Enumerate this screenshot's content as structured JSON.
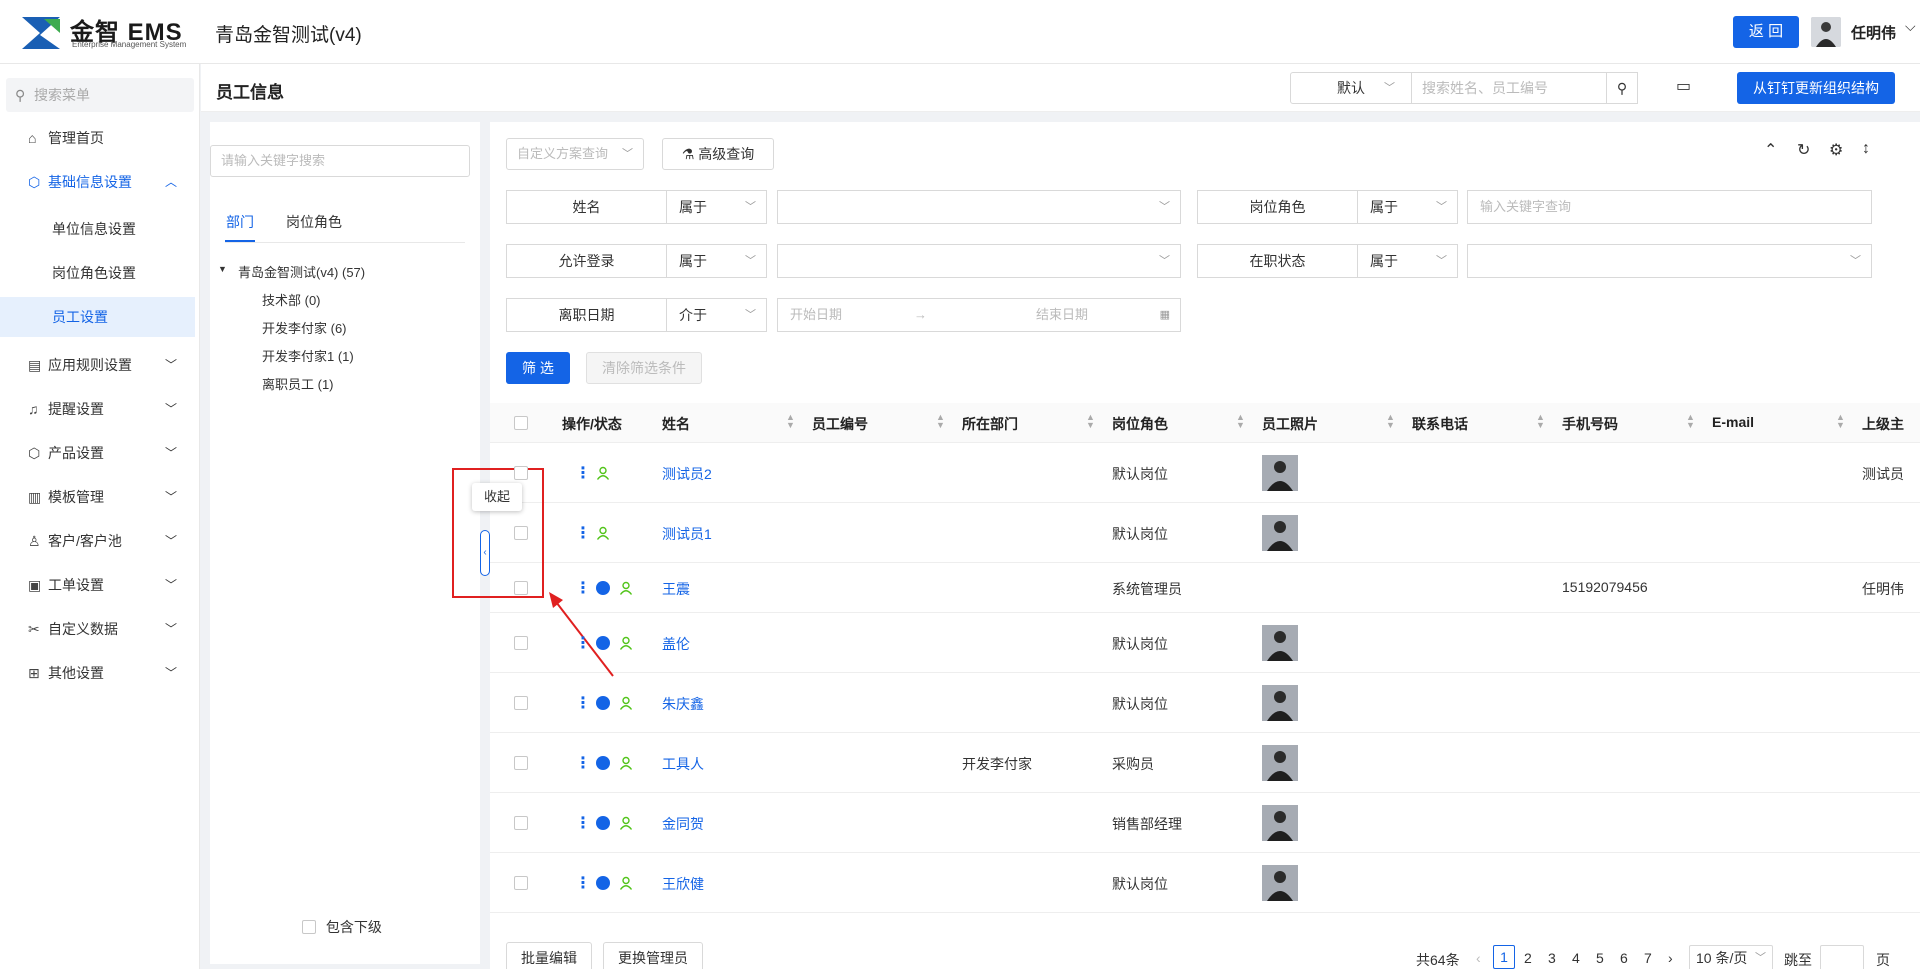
{
  "header": {
    "logo_text": "金智 EMS",
    "logo_sub": "Enterprise Management System",
    "org_title": "青岛金智测试(v4)",
    "back_label": "返 回",
    "user_name": "任明伟"
  },
  "sidebar": {
    "search_placeholder": "搜索菜单",
    "items": [
      {
        "label": "管理首页"
      },
      {
        "label": "基础信息设置"
      },
      {
        "label": "应用规则设置"
      },
      {
        "label": "提醒设置"
      },
      {
        "label": "产品设置"
      },
      {
        "label": "模板管理"
      },
      {
        "label": "客户/客户池"
      },
      {
        "label": "工单设置"
      },
      {
        "label": "自定义数据"
      },
      {
        "label": "其他设置"
      }
    ],
    "sub_items": [
      {
        "label": "单位信息设置"
      },
      {
        "label": "岗位角色设置"
      },
      {
        "label": "员工设置"
      }
    ]
  },
  "page": {
    "title": "员工信息",
    "default_select": "默认",
    "search_placeholder": "搜索姓名、员工编号",
    "dingtalk_btn": "从钉钉更新组织结构"
  },
  "tree": {
    "search_placeholder": "请输入关键字搜索",
    "tabs": [
      "部门",
      "岗位角色"
    ],
    "root": "青岛金智测试(v4) (57)",
    "children": [
      "技术部 (0)",
      "开发李付家 (6)",
      "开发李付家1 (1)",
      "离职员工 (1)"
    ],
    "include_sub": "包含下级",
    "collapse_tip": "收起"
  },
  "filters": {
    "custom_query": "自定义方案查询",
    "adv_query": "高级查询",
    "rows": [
      {
        "label": "姓名",
        "op": "属于",
        "value": ""
      },
      {
        "label": "岗位角色",
        "op": "属于",
        "value": "输入关键字查询"
      },
      {
        "label": "允许登录",
        "op": "属于",
        "value": ""
      },
      {
        "label": "在职状态",
        "op": "属于",
        "value": ""
      },
      {
        "label": "离职日期",
        "op": "介于",
        "start": "开始日期",
        "arrow": "→",
        "end": "结束日期"
      }
    ],
    "filter_btn": "筛 选",
    "clear_btn": "清除筛选条件"
  },
  "table": {
    "columns": [
      "操作/状态",
      "姓名",
      "员工编号",
      "所在部门",
      "岗位角色",
      "员工照片",
      "联系电话",
      "手机号码",
      "E-mail",
      "上级主"
    ],
    "rows": [
      {
        "name": "测试员2",
        "dept": "",
        "role": "默认岗位",
        "mobile": "",
        "superior": "测试员",
        "admin": false,
        "photo": true
      },
      {
        "name": "测试员1",
        "dept": "",
        "role": "默认岗位",
        "mobile": "",
        "superior": "",
        "admin": false,
        "photo": true
      },
      {
        "name": "王震",
        "dept": "",
        "role": "系统管理员",
        "mobile": "15192079456",
        "superior": "任明伟",
        "admin": true,
        "photo": false
      },
      {
        "name": "盖伦",
        "dept": "",
        "role": "默认岗位",
        "mobile": "",
        "superior": "",
        "admin": true,
        "photo": true
      },
      {
        "name": "朱庆鑫",
        "dept": "",
        "role": "默认岗位",
        "mobile": "",
        "superior": "",
        "admin": true,
        "photo": true
      },
      {
        "name": "工具人",
        "dept": "开发李付家",
        "role": "采购员",
        "mobile": "",
        "superior": "",
        "admin": true,
        "photo": true
      },
      {
        "name": "金同贺",
        "dept": "",
        "role": "销售部经理",
        "mobile": "",
        "superior": "",
        "admin": true,
        "photo": true
      },
      {
        "name": "王欣健",
        "dept": "",
        "role": "默认岗位",
        "mobile": "",
        "superior": "",
        "admin": true,
        "photo": true
      }
    ]
  },
  "footer": {
    "batch_edit": "批量编辑",
    "change_admin": "更换管理员",
    "total": "共64条",
    "pages": [
      "1",
      "2",
      "3",
      "4",
      "5",
      "6",
      "7"
    ],
    "page_size": "10 条/页",
    "jump_label": "跳至",
    "page_unit": "页"
  },
  "colors": {
    "primary": "#1464e6",
    "annotation": "#e02020",
    "status_green": "#52c41a"
  }
}
